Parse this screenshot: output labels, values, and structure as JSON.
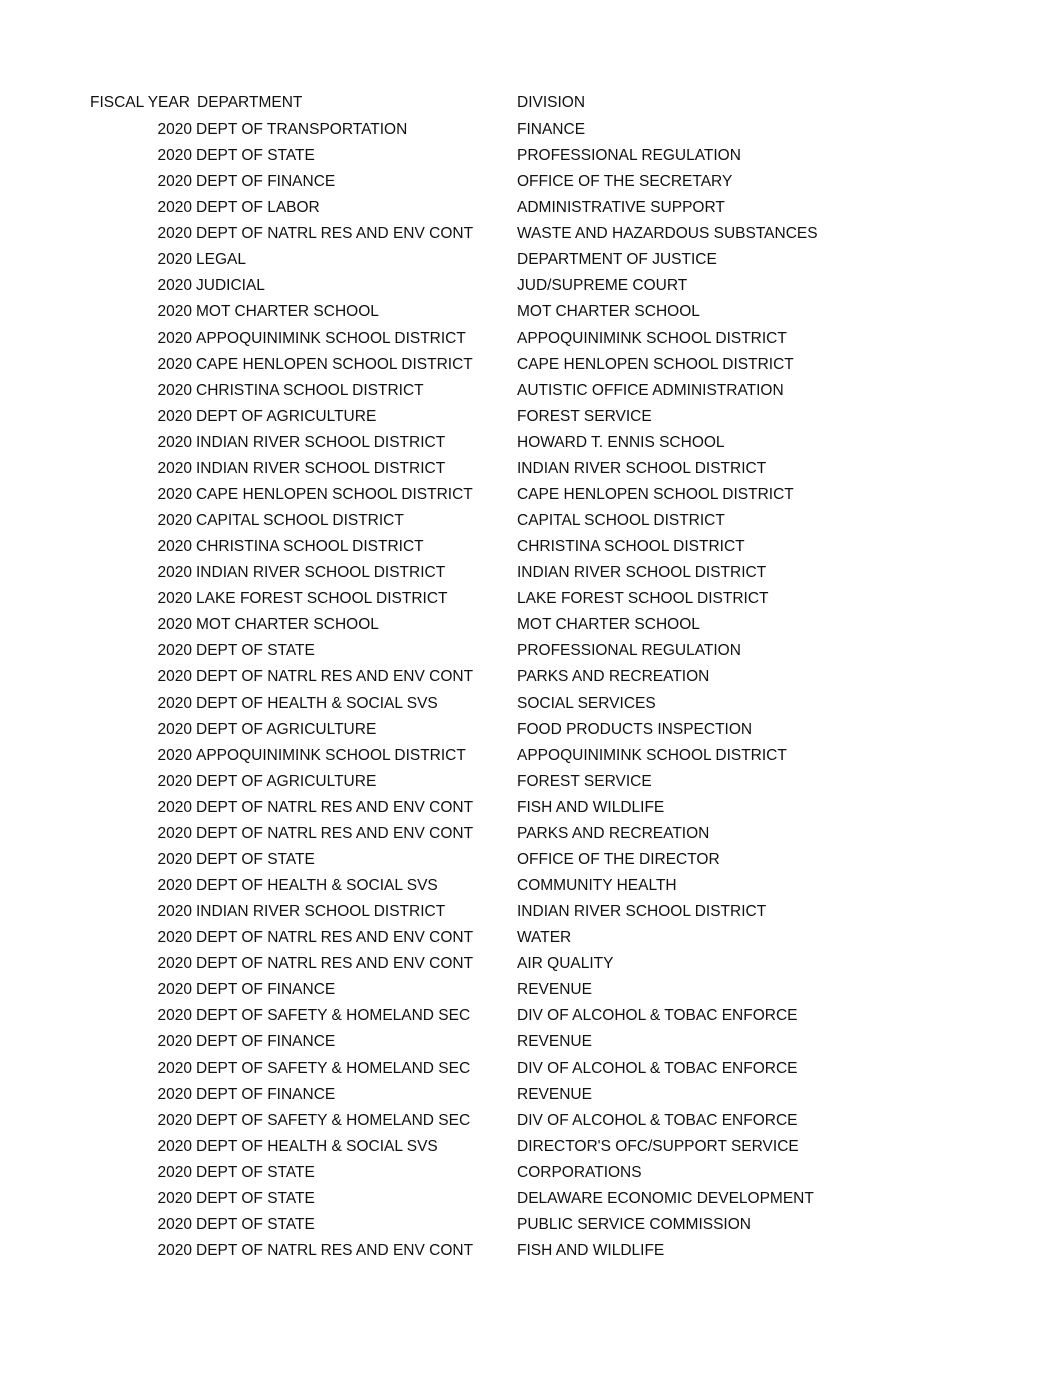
{
  "header": {
    "fiscal_year": "FISCAL YEAR",
    "department": "DEPARTMENT",
    "division": "DIVISION"
  },
  "rows": [
    {
      "year": "2020",
      "department": "DEPT OF TRANSPORTATION",
      "division": "FINANCE"
    },
    {
      "year": "2020",
      "department": "DEPT OF STATE",
      "division": "PROFESSIONAL REGULATION"
    },
    {
      "year": "2020",
      "department": "DEPT OF FINANCE",
      "division": "OFFICE OF THE SECRETARY"
    },
    {
      "year": "2020",
      "department": "DEPT OF LABOR",
      "division": "ADMINISTRATIVE SUPPORT"
    },
    {
      "year": "2020",
      "department": "DEPT OF NATRL RES AND ENV CONT",
      "division": "WASTE AND HAZARDOUS SUBSTANCES"
    },
    {
      "year": "2020",
      "department": "LEGAL",
      "division": "DEPARTMENT OF JUSTICE"
    },
    {
      "year": "2020",
      "department": "JUDICIAL",
      "division": "JUD/SUPREME COURT"
    },
    {
      "year": "2020",
      "department": "MOT CHARTER SCHOOL",
      "division": "MOT CHARTER SCHOOL"
    },
    {
      "year": "2020",
      "department": "APPOQUINIMINK SCHOOL DISTRICT",
      "division": "APPOQUINIMINK SCHOOL DISTRICT"
    },
    {
      "year": "2020",
      "department": "CAPE HENLOPEN SCHOOL DISTRICT",
      "division": "CAPE HENLOPEN SCHOOL DISTRICT"
    },
    {
      "year": "2020",
      "department": "CHRISTINA SCHOOL DISTRICT",
      "division": "AUTISTIC OFFICE ADMINISTRATION"
    },
    {
      "year": "2020",
      "department": "DEPT OF AGRICULTURE",
      "division": "FOREST SERVICE"
    },
    {
      "year": "2020",
      "department": "INDIAN RIVER SCHOOL DISTRICT",
      "division": "HOWARD T. ENNIS SCHOOL"
    },
    {
      "year": "2020",
      "department": "INDIAN RIVER SCHOOL DISTRICT",
      "division": "INDIAN RIVER SCHOOL DISTRICT"
    },
    {
      "year": "2020",
      "department": "CAPE HENLOPEN SCHOOL DISTRICT",
      "division": "CAPE HENLOPEN SCHOOL DISTRICT"
    },
    {
      "year": "2020",
      "department": "CAPITAL SCHOOL DISTRICT",
      "division": "CAPITAL SCHOOL DISTRICT"
    },
    {
      "year": "2020",
      "department": "CHRISTINA SCHOOL DISTRICT",
      "division": "CHRISTINA SCHOOL DISTRICT"
    },
    {
      "year": "2020",
      "department": "INDIAN RIVER SCHOOL DISTRICT",
      "division": "INDIAN RIVER SCHOOL DISTRICT"
    },
    {
      "year": "2020",
      "department": "LAKE FOREST SCHOOL DISTRICT",
      "division": "LAKE FOREST SCHOOL DISTRICT"
    },
    {
      "year": "2020",
      "department": "MOT CHARTER SCHOOL",
      "division": "MOT CHARTER SCHOOL"
    },
    {
      "year": "2020",
      "department": "DEPT OF STATE",
      "division": "PROFESSIONAL REGULATION"
    },
    {
      "year": "2020",
      "department": "DEPT OF NATRL RES AND ENV CONT",
      "division": "PARKS AND RECREATION"
    },
    {
      "year": "2020",
      "department": "DEPT OF HEALTH & SOCIAL SVS",
      "division": "SOCIAL SERVICES"
    },
    {
      "year": "2020",
      "department": "DEPT OF AGRICULTURE",
      "division": "FOOD PRODUCTS INSPECTION"
    },
    {
      "year": "2020",
      "department": "APPOQUINIMINK SCHOOL DISTRICT",
      "division": "APPOQUINIMINK SCHOOL DISTRICT"
    },
    {
      "year": "2020",
      "department": "DEPT OF AGRICULTURE",
      "division": "FOREST SERVICE"
    },
    {
      "year": "2020",
      "department": "DEPT OF NATRL RES AND ENV CONT",
      "division": "FISH AND WILDLIFE"
    },
    {
      "year": "2020",
      "department": "DEPT OF NATRL RES AND ENV CONT",
      "division": "PARKS AND RECREATION"
    },
    {
      "year": "2020",
      "department": "DEPT OF STATE",
      "division": "OFFICE OF THE DIRECTOR"
    },
    {
      "year": "2020",
      "department": "DEPT OF HEALTH & SOCIAL SVS",
      "division": "COMMUNITY HEALTH"
    },
    {
      "year": "2020",
      "department": "INDIAN RIVER SCHOOL DISTRICT",
      "division": "INDIAN RIVER SCHOOL DISTRICT"
    },
    {
      "year": "2020",
      "department": "DEPT OF NATRL RES AND ENV CONT",
      "division": "WATER"
    },
    {
      "year": "2020",
      "department": "DEPT OF NATRL RES AND ENV CONT",
      "division": "AIR QUALITY"
    },
    {
      "year": "2020",
      "department": "DEPT OF FINANCE",
      "division": "REVENUE"
    },
    {
      "year": "2020",
      "department": "DEPT OF SAFETY & HOMELAND SEC",
      "division": "DIV OF ALCOHOL & TOBAC ENFORCE"
    },
    {
      "year": "2020",
      "department": "DEPT OF FINANCE",
      "division": "REVENUE"
    },
    {
      "year": "2020",
      "department": "DEPT OF SAFETY & HOMELAND SEC",
      "division": "DIV OF ALCOHOL & TOBAC ENFORCE"
    },
    {
      "year": "2020",
      "department": "DEPT OF FINANCE",
      "division": "REVENUE"
    },
    {
      "year": "2020",
      "department": "DEPT OF SAFETY & HOMELAND SEC",
      "division": "DIV OF ALCOHOL & TOBAC ENFORCE"
    },
    {
      "year": "2020",
      "department": "DEPT OF HEALTH & SOCIAL SVS",
      "division": "DIRECTOR'S OFC/SUPPORT SERVICE"
    },
    {
      "year": "2020",
      "department": "DEPT OF STATE",
      "division": "CORPORATIONS"
    },
    {
      "year": "2020",
      "department": "DEPT OF STATE",
      "division": "DELAWARE ECONOMIC DEVELOPMENT"
    },
    {
      "year": "2020",
      "department": "DEPT OF STATE",
      "division": "PUBLIC SERVICE COMMISSION"
    },
    {
      "year": "2020",
      "department": "DEPT OF NATRL RES AND ENV CONT",
      "division": "FISH AND WILDLIFE"
    }
  ]
}
